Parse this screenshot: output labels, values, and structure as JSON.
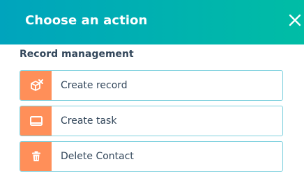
{
  "header": {
    "title": "Choose an action",
    "background_start": "#00a4bd",
    "background_end": "#00bda5",
    "close_icon": "close-icon"
  },
  "section": {
    "label": "Record management"
  },
  "actions": [
    {
      "label": "Create record",
      "icon": "create-record-icon"
    },
    {
      "label": "Create task",
      "icon": "task-icon"
    },
    {
      "label": "Delete Contact",
      "icon": "trash-icon"
    }
  ],
  "colors": {
    "icon_background": "#ff8f59",
    "card_border": "#7fd1de",
    "text": "#33475b"
  }
}
